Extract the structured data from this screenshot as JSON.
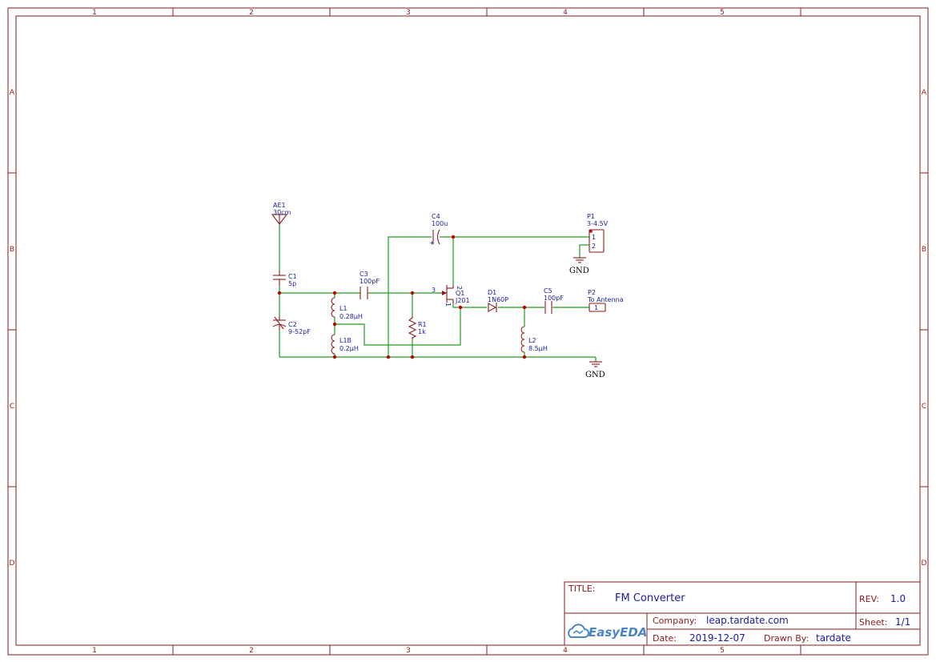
{
  "frame": {
    "columns": [
      "1",
      "2",
      "3",
      "4",
      "5"
    ],
    "rows": [
      "A",
      "B",
      "C",
      "D"
    ]
  },
  "title_block": {
    "title_key": "TITLE:",
    "title": "FM Converter",
    "rev_key": "REV:",
    "rev": "1.0",
    "company_key": "Company:",
    "company": "leap.tardate.com",
    "sheet_key": "Sheet:",
    "sheet": "1/1",
    "date_key": "Date:",
    "date": "2019-12-07",
    "drawn_by_key": "Drawn By:",
    "drawn_by": "tardate",
    "logo": "EasyEDA"
  },
  "components": {
    "ae1": {
      "ref": "AE1",
      "value": "30cm"
    },
    "c1": {
      "ref": "C1",
      "value": "5p"
    },
    "c2": {
      "ref": "C2",
      "value": "9-52pF"
    },
    "c3": {
      "ref": "C3",
      "value": "100pF"
    },
    "c4": {
      "ref": "C4",
      "value": "100u",
      "polarity": "+"
    },
    "c5": {
      "ref": "C5",
      "value": "100pF"
    },
    "l1": {
      "ref": "L1",
      "value": "0.28µH"
    },
    "l1b": {
      "ref": "L1B",
      "value": "0.2µH"
    },
    "l2": {
      "ref": "L2",
      "value": "8.5µH"
    },
    "r1": {
      "ref": "R1",
      "value": "1k"
    },
    "q1": {
      "ref": "Q1",
      "value": "J201",
      "pin_gate": "3",
      "pin_drain": "2",
      "pin_source": "1"
    },
    "d1": {
      "ref": "D1",
      "value": "1N60P"
    },
    "p1": {
      "ref": "P1",
      "value": "3-4.5V",
      "pin1": "1",
      "pin2": "2"
    },
    "p2": {
      "ref": "P2",
      "value": "To Antenna",
      "pin1": "1"
    },
    "gnd1": {
      "label": "GND"
    },
    "gnd2": {
      "label": "GND"
    }
  },
  "colors": {
    "frame": "#8b1a1a",
    "wire": "#1f9e1f",
    "label": "#1a1aa0",
    "junction": "#c00000"
  }
}
